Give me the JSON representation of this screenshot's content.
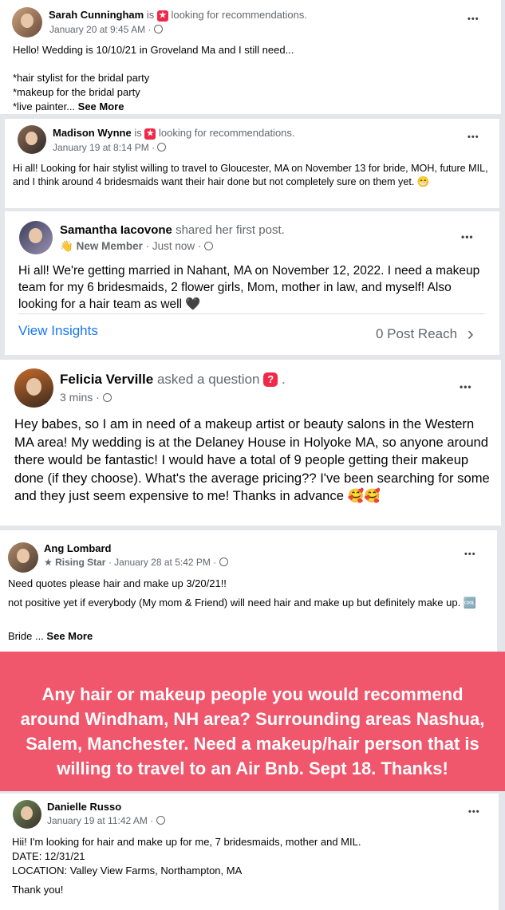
{
  "posts": [
    {
      "author": "Sarah Cunningham",
      "verb": "is",
      "activity": "looking for recommendations.",
      "time": "January 20 at 9:45 AM ·",
      "body": "Hello! Wedding is 10/10/21 in Groveland Ma and I still need...\n\n*hair stylist for the bridal party\n*makeup for the bridal party\n*live painter... ",
      "see_more": "See More"
    },
    {
      "author": "Madison Wynne",
      "verb": "is",
      "activity": "looking for recommendations.",
      "time": "January 19 at 8:14 PM ·",
      "body": "Hi all! Looking for hair stylist willing to travel to Gloucester, MA on November 13 for bride, MOH, future MIL, and I think around 4 bridesmaids want their hair done but not completely sure on them yet. 😁"
    },
    {
      "author": "Samantha Iacovone",
      "verb": "shared her first post.",
      "badge": "New Member",
      "time": "· Just now ·",
      "body": "Hi all! We're getting married in Nahant, MA on November 12, 2022. I need a makeup team for my 6 bridesmaids, 2 flower girls, Mom, mother in law, and myself! Also looking for a hair team as well 🖤",
      "insights": "View Insights",
      "reach": "0 Post Reach"
    },
    {
      "author": "Felicia Verville",
      "verb": "asked a question",
      "verb_end": ".",
      "time": "3 mins ·",
      "body": "Hey babes, so I am in need of a makeup artist or beauty salons in the Western MA area! My wedding is at the Delaney House in Holyoke MA, so anyone around there would be fantastic! I would have a total of 9 people getting their makeup done (if they choose). What's the average pricing?? I've been searching for some and they just seem expensive to me! Thanks in advance 🥰🥰"
    },
    {
      "author": "Ang Lombard",
      "badge": "Rising Star",
      "time": "· January 28 at 5:42 PM ·",
      "body_line1": "Need quotes please hair and make up 3/20/21!!",
      "body_line2": "not positive yet if everybody (My mom & Friend) will need hair and make up but definitely make up. 🆒",
      "body_line3": "Bride ... ",
      "see_more": "See More"
    },
    {
      "author": "Danielle Russo",
      "time": "January 19 at 11:42 AM ·",
      "body_line1": "Hii! I'm looking for hair and make up for me, 7 bridesmaids, mother and MIL.",
      "body_line2": "DATE: 12/31/21",
      "body_line3": "LOCATION: Valley View Farms, Northampton, MA",
      "body_line4": "Thank you!"
    }
  ],
  "banner": {
    "text": "Any hair or makeup people you would recommend around Windham, NH area? Surrounding areas Nashua, Salem, Manchester. Need a makeup/hair person that is willing to travel to an Air Bnb. Sept 18. Thanks!",
    "color": "#f0566c"
  },
  "icons": {
    "more": "more-options-icon",
    "privacy": "globe-icon",
    "recommendation": "recommendation-icon",
    "question": "question-icon"
  },
  "glyphs": {
    "more": "•••",
    "rec": "★",
    "question": "?",
    "member": "👋",
    "star": "★",
    "chevron": "›"
  }
}
